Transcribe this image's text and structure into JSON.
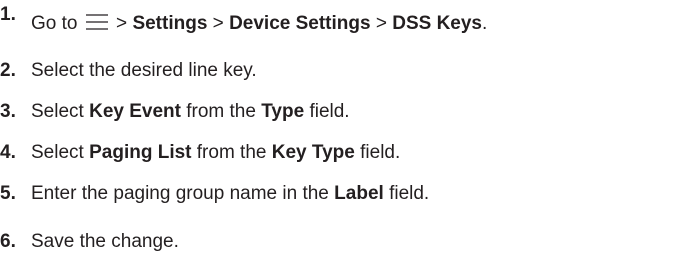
{
  "steps": [
    {
      "number": "1.",
      "parts": {
        "t1": "Go to",
        "sep1": ">",
        "b1": "Settings",
        "sep2": ">",
        "b2": "Device Settings",
        "sep3": ">",
        "b3": "DSS Keys",
        "end": "."
      },
      "icon": "menu-icon"
    },
    {
      "number": "2.",
      "parts": {
        "t1": "Select the desired line key."
      }
    },
    {
      "number": "3.",
      "parts": {
        "t1": "Select",
        "b1": "Key Event",
        "t2": "from the",
        "b2": "Type",
        "t3": "field."
      }
    },
    {
      "number": "4.",
      "parts": {
        "t1": "Select",
        "b1": "Paging List",
        "t2": "from the",
        "b2": "Key Type",
        "t3": "field."
      }
    },
    {
      "number": "5.",
      "parts": {
        "t1": "Enter the paging group name in the",
        "b1": "Label",
        "t2": "field."
      }
    },
    {
      "number": "6.",
      "parts": {
        "t1": "Save the change."
      }
    }
  ],
  "colors": {
    "text": "#231f20",
    "background": "#ffffff"
  }
}
